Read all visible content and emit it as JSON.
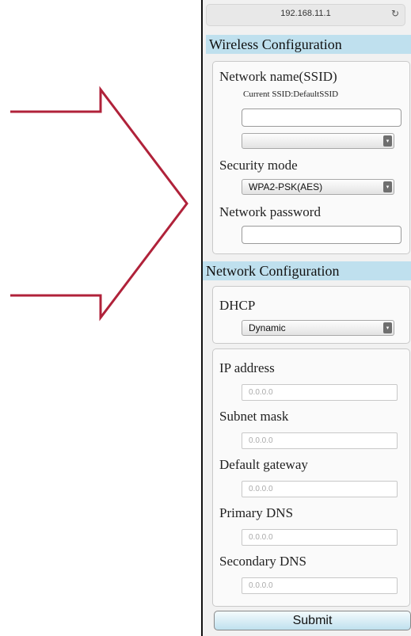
{
  "browser": {
    "url": "192.168.11.1",
    "reload_icon": "reload-icon"
  },
  "wireless": {
    "header": "Wireless Configuration",
    "ssid_label": "Network name(SSID)",
    "current_ssid": "Current SSID:DefaultSSID",
    "ssid_value": "",
    "ssid_select_value": "",
    "security_label": "Security mode",
    "security_value": "WPA2-PSK(AES)",
    "password_label": "Network password",
    "password_value": ""
  },
  "network": {
    "header": "Network Configuration",
    "dhcp_label": "DHCP",
    "dhcp_value": "Dynamic",
    "fields": [
      {
        "label": "IP address",
        "placeholder": "0.0.0.0"
      },
      {
        "label": "Subnet mask",
        "placeholder": "0.0.0.0"
      },
      {
        "label": "Default gateway",
        "placeholder": "0.0.0.0"
      },
      {
        "label": "Primary DNS",
        "placeholder": "0.0.0.0"
      },
      {
        "label": "Secondary DNS",
        "placeholder": "0.0.0.0"
      }
    ]
  },
  "submit_label": "Submit",
  "colors": {
    "header_bg": "#bfe0ee",
    "arrow": "#b0223a"
  }
}
